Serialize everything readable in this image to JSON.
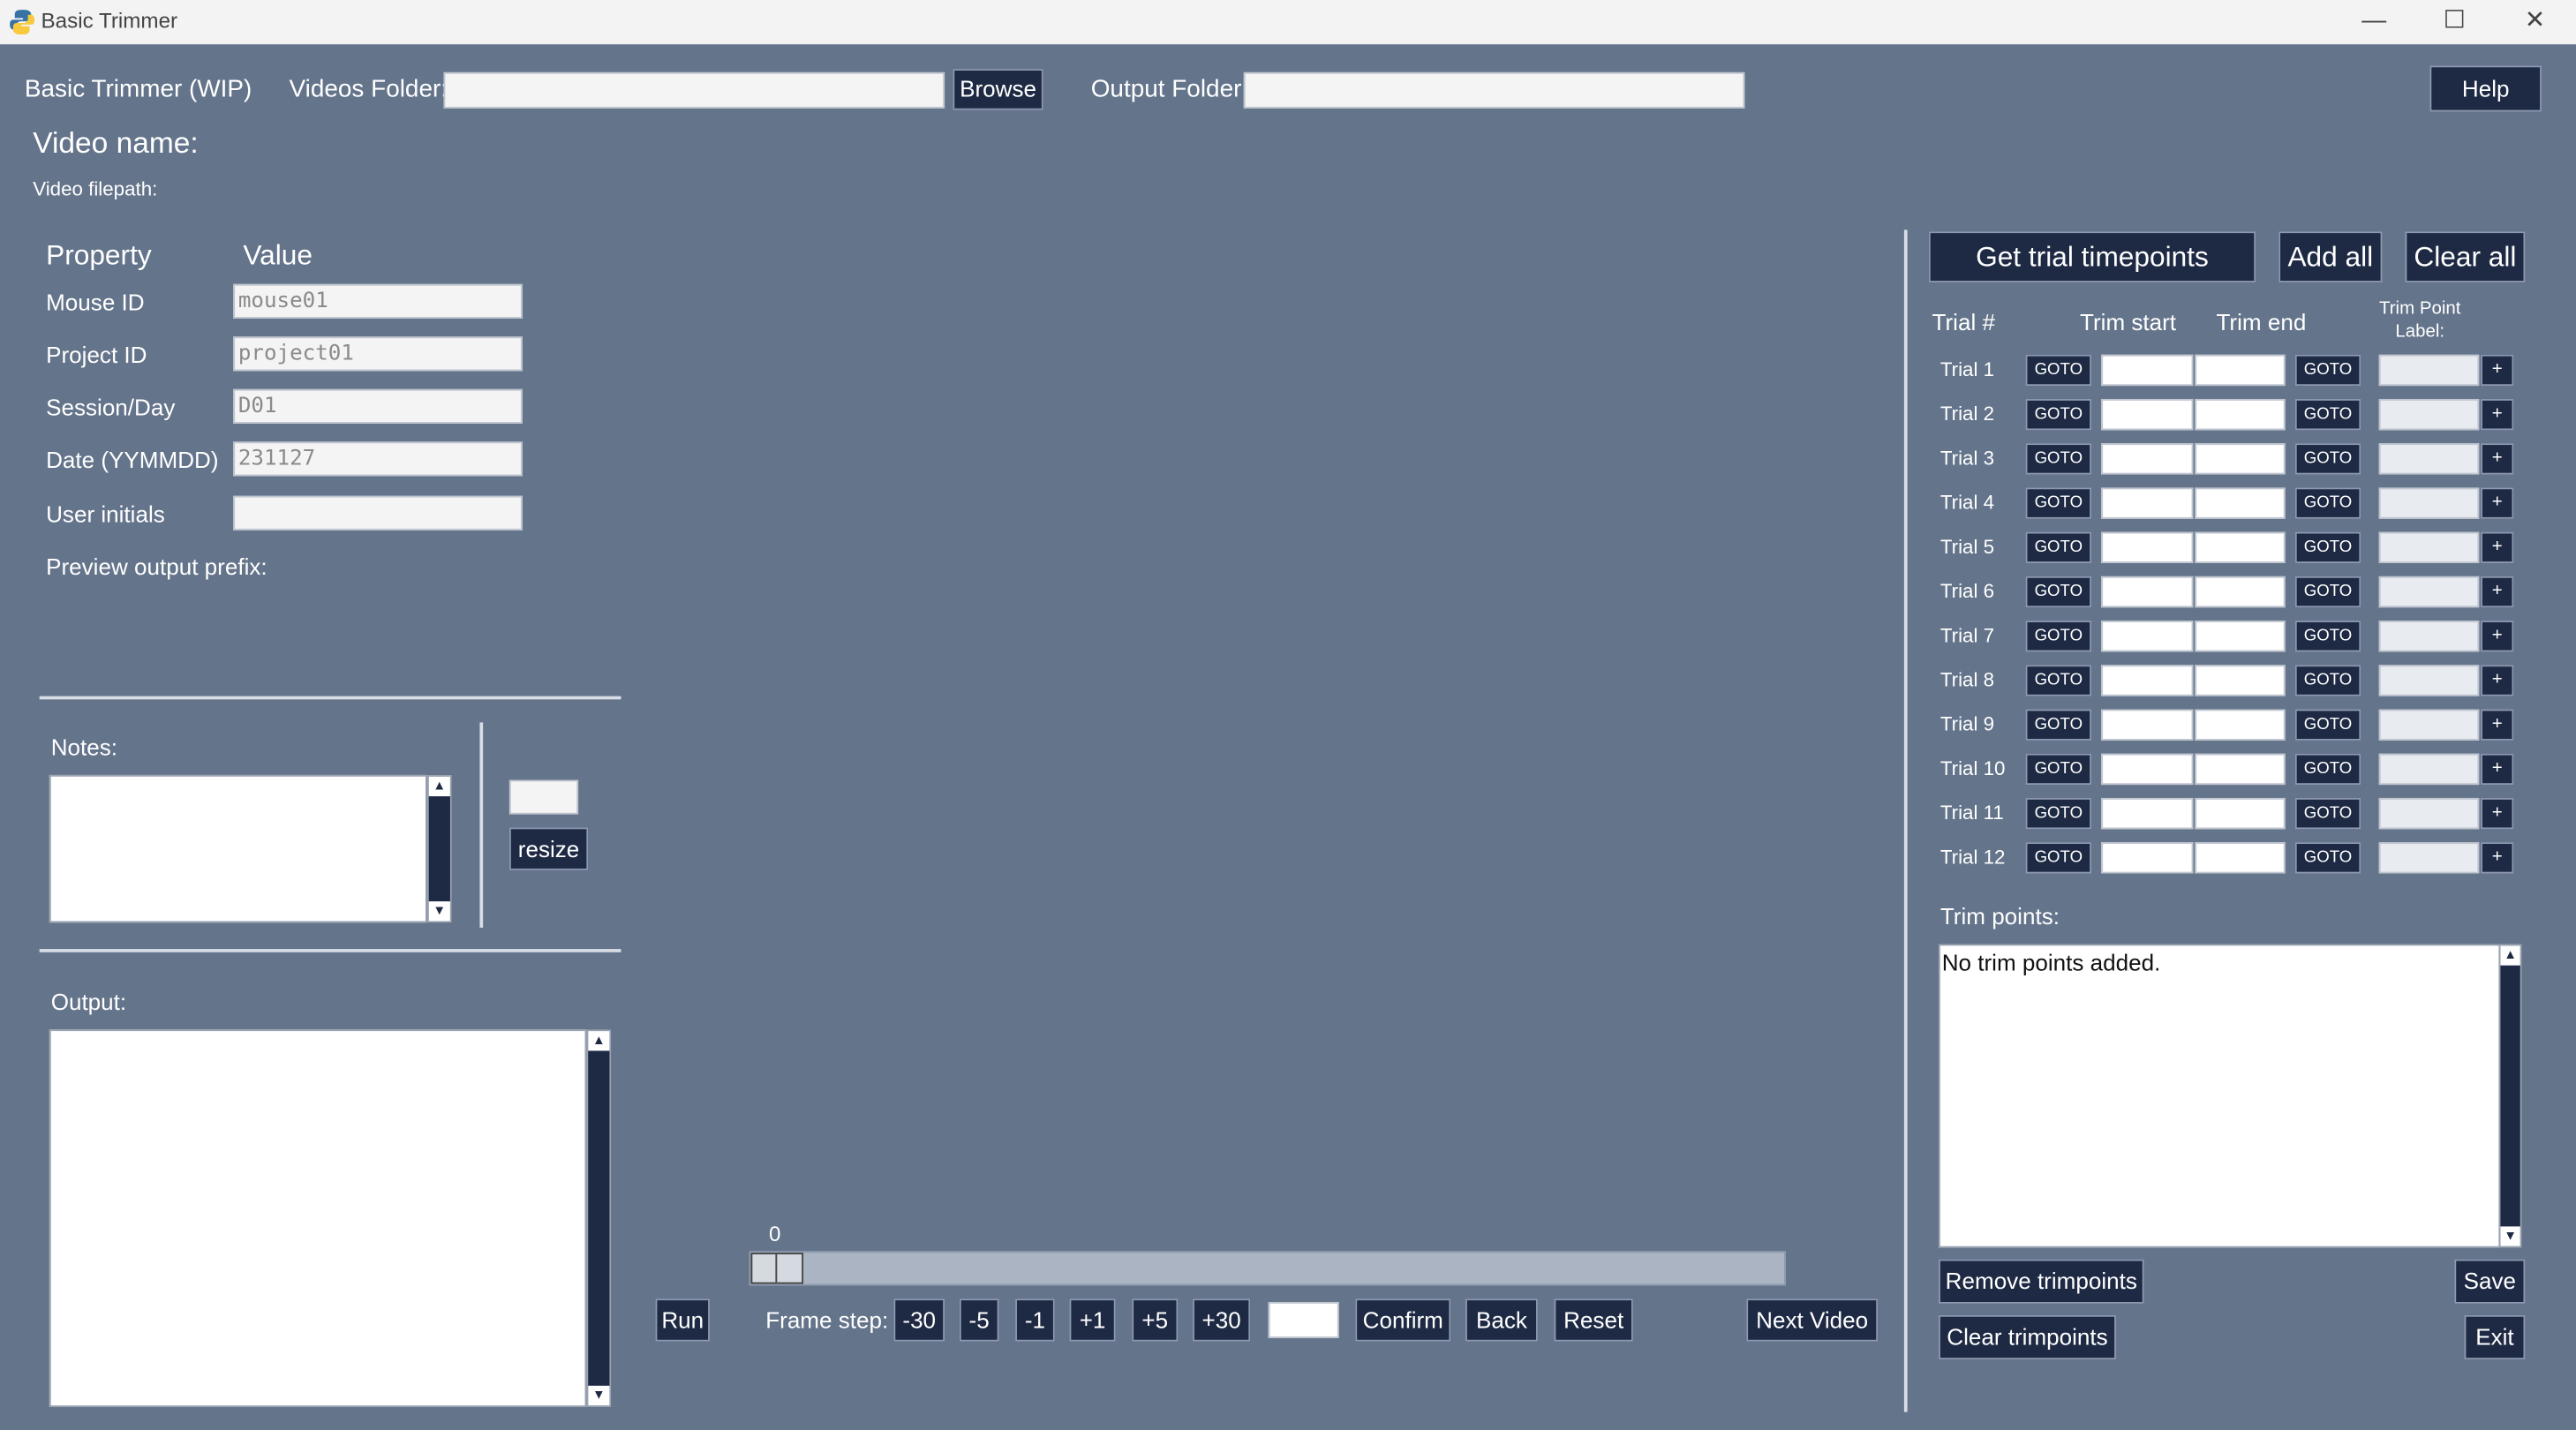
{
  "window": {
    "title": "Basic Trimmer",
    "minimize": "—",
    "maximize": "☐",
    "close": "✕"
  },
  "header": {
    "app_label": "Basic Trimmer (WIP)",
    "videos_folder_label": "Videos Folder:",
    "videos_folder_value": "",
    "browse_label": "Browse",
    "output_folder_label": "Output Folder:",
    "output_folder_value": "",
    "help_label": "Help"
  },
  "video": {
    "name_label": "Video name:",
    "filepath_label": "Video filepath:"
  },
  "properties": {
    "header_property": "Property",
    "header_value": "Value",
    "rows": [
      {
        "label": "Mouse ID",
        "value": "mouse01"
      },
      {
        "label": "Project ID",
        "value": "project01"
      },
      {
        "label": "Session/Day",
        "value": "D01"
      },
      {
        "label": "Date (YYMMDD)",
        "value": "231127"
      },
      {
        "label": "User initials",
        "value": ""
      }
    ],
    "preview_label": "Preview output prefix:"
  },
  "notes": {
    "label": "Notes:",
    "value": "",
    "resize_value": "",
    "resize_label": "resize"
  },
  "output": {
    "label": "Output:",
    "value": ""
  },
  "player": {
    "frame_value": "0",
    "slider_fraction": 0,
    "run_label": "Run",
    "frame_step_label": "Frame step:",
    "steps": [
      "-30",
      "-5",
      "-1",
      "+1",
      "+5",
      "+30"
    ],
    "frame_input": "",
    "confirm_label": "Confirm",
    "back_label": "Back",
    "reset_label": "Reset",
    "next_video_label": "Next Video"
  },
  "trials": {
    "get_timepoints_label": "Get trial timepoints",
    "add_all_label": "Add all",
    "clear_all_label": "Clear all",
    "col_trial": "Trial #",
    "col_start": "Trim start",
    "col_end": "Trim end",
    "col_label": "Trim Point Label:",
    "goto_label": "GOTO",
    "plus_label": "+",
    "rows": [
      "Trial 1",
      "Trial 2",
      "Trial 3",
      "Trial 4",
      "Trial 5",
      "Trial 6",
      "Trial 7",
      "Trial 8",
      "Trial 9",
      "Trial 10",
      "Trial 11",
      "Trial 12"
    ]
  },
  "trimpoints": {
    "label": "Trim points:",
    "text": "No trim points added.",
    "remove_label": "Remove trimpoints",
    "clear_label": "Clear trimpoints",
    "save_label": "Save",
    "exit_label": "Exit"
  },
  "colors": {
    "background": "#64748b",
    "button": "#1e2a44",
    "titlebar": "#f3f3f3"
  },
  "icons": {
    "app": "python-logo-icon"
  }
}
